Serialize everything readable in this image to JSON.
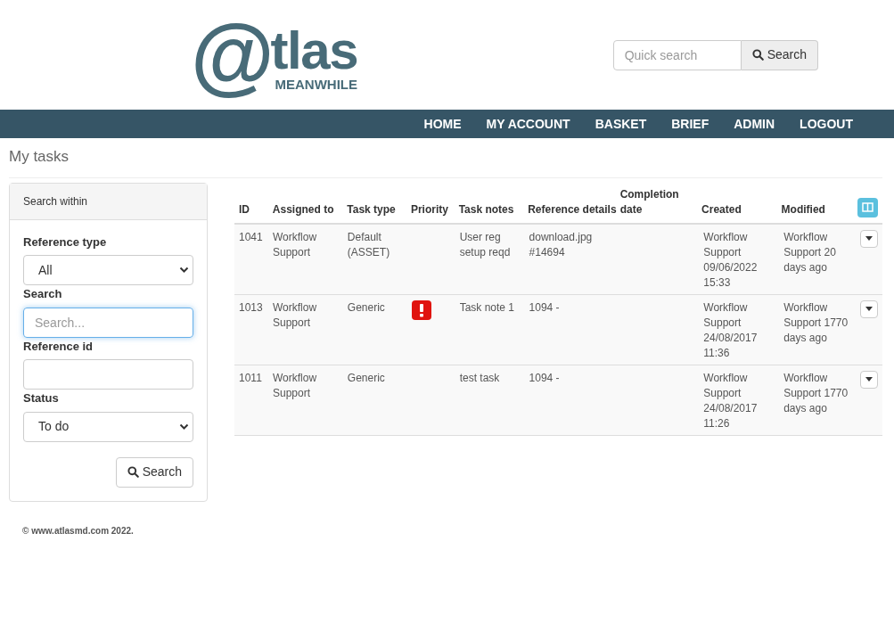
{
  "logo": {
    "mark": "@",
    "word": "tlas",
    "tagline": "MEANWHILE"
  },
  "quick_search": {
    "placeholder": "Quick search",
    "button": "Search"
  },
  "nav": [
    "HOME",
    "MY ACCOUNT",
    "BASKET",
    "BRIEF",
    "ADMIN",
    "LOGOUT"
  ],
  "page_title": "My tasks",
  "sidebar": {
    "title": "Search within",
    "fields": [
      {
        "kind": "select",
        "label": "Reference type",
        "value": "All"
      },
      {
        "kind": "text",
        "label": "Search",
        "placeholder": "Search...",
        "focused": true
      },
      {
        "kind": "text",
        "label": "Reference id",
        "focused": false
      },
      {
        "kind": "select",
        "label": "Status",
        "value": "To do"
      }
    ],
    "button": "Search"
  },
  "table": {
    "columns": [
      "ID",
      "Assigned to",
      "Task type",
      "Priority",
      "Task notes",
      "Reference details",
      "Completion date",
      "Created",
      "Modified"
    ],
    "rows": [
      {
        "id": "1041",
        "assigned": "Workflow Support",
        "type": "Default (ASSET)",
        "high_priority": false,
        "notes": "User reg setup reqd",
        "reference": "download.jpg #14694",
        "created": "Workflow Support 09/06/2022 15:33",
        "modified": "Workflow Support 20 days ago"
      },
      {
        "id": "1013",
        "assigned": "Workflow Support",
        "type": "Generic",
        "high_priority": true,
        "notes": "Task note 1",
        "reference": "1094 -",
        "created": "Workflow Support 24/08/2017 11:36",
        "modified": "Workflow Support 1770 days ago"
      },
      {
        "id": "1011",
        "assigned": "Workflow Support",
        "type": "Generic",
        "high_priority": false,
        "notes": "test task",
        "reference": "1094 -",
        "created": "Workflow Support 24/08/2017 11:26",
        "modified": "Workflow Support 1770 days ago"
      }
    ]
  },
  "footer": "© www.atlasmd.com 2022."
}
